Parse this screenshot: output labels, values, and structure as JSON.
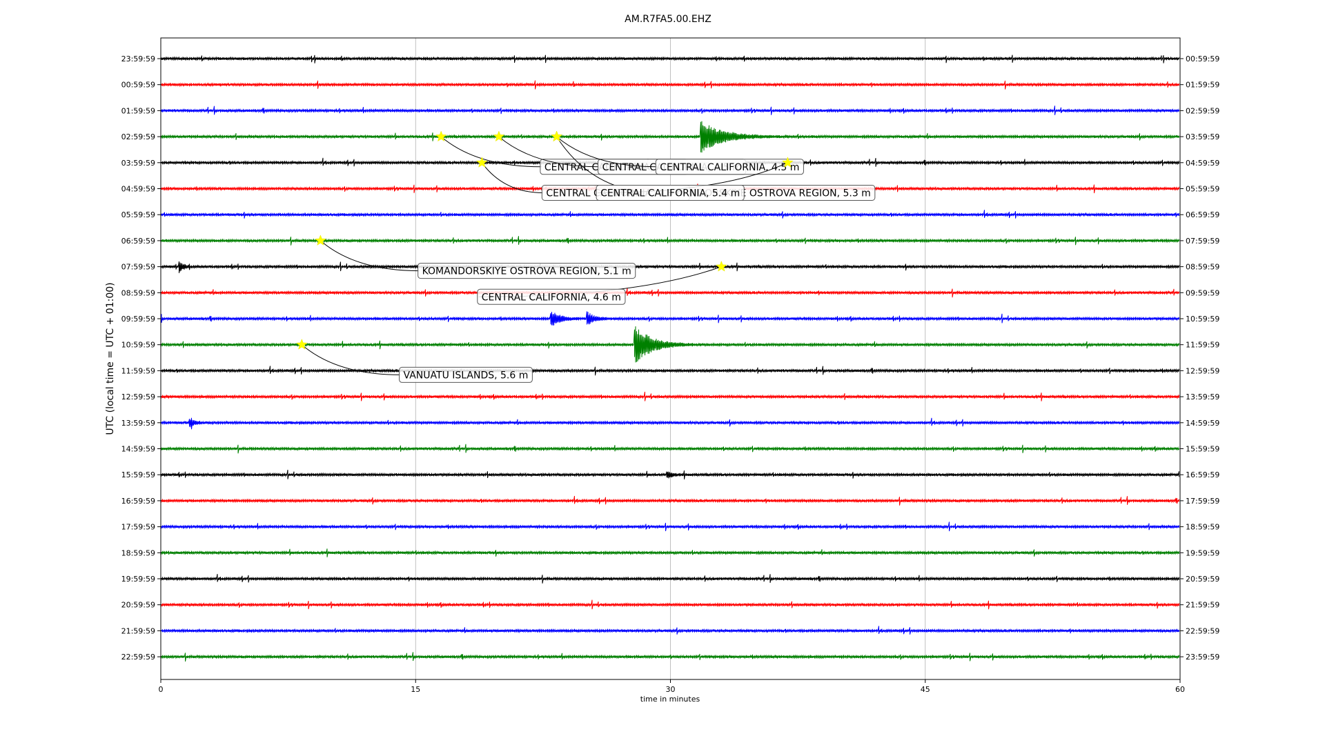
{
  "chart_data": {
    "type": "line",
    "title": "AM.R7FA5.00.EHZ",
    "xlabel": "time in minutes",
    "ylabel": "UTC (local time = UTC + 01:00)",
    "xlim": [
      0,
      60
    ],
    "x_ticks": [
      0,
      15,
      30,
      45,
      60
    ],
    "x_grid": true,
    "trace_colors": [
      "#000000",
      "#ff0000",
      "#0000ff",
      "#008000"
    ],
    "rows_left": [
      "23:59:59",
      "00:59:59",
      "01:59:59",
      "02:59:59",
      "03:59:59",
      "04:59:59",
      "05:59:59",
      "06:59:59",
      "07:59:59",
      "08:59:59",
      "09:59:59",
      "10:59:59",
      "11:59:59",
      "12:59:59",
      "13:59:59",
      "14:59:59",
      "15:59:59",
      "16:59:59",
      "17:59:59",
      "18:59:59",
      "19:59:59",
      "20:59:59",
      "21:59:59",
      "22:59:59"
    ],
    "rows_right": [
      "00:59:59",
      "01:59:59",
      "02:59:59",
      "03:59:59",
      "04:59:59",
      "05:59:59",
      "06:59:59",
      "07:59:59",
      "08:59:59",
      "09:59:59",
      "10:59:59",
      "11:59:59",
      "12:59:59",
      "13:59:59",
      "14:59:59",
      "15:59:59",
      "16:59:59",
      "17:59:59",
      "18:59:59",
      "19:59:59",
      "20:59:59",
      "21:59:59",
      "22:59:59",
      "23:59:59"
    ],
    "signals": [
      {
        "row": 3,
        "minute": 31.8,
        "amplitude": 22,
        "decay": 1.2
      },
      {
        "row": 11,
        "minute": 27.9,
        "amplitude": 28,
        "decay": 0.9
      },
      {
        "row": 10,
        "minute": 23.0,
        "amplitude": 11,
        "decay": 0.5
      },
      {
        "row": 10,
        "minute": 25.1,
        "amplitude": 9,
        "decay": 0.4
      },
      {
        "row": 8,
        "minute": 1.1,
        "amplitude": 9,
        "decay": 0.2
      },
      {
        "row": 14,
        "minute": 1.7,
        "amplitude": 6,
        "decay": 0.3
      },
      {
        "row": 16,
        "minute": 29.8,
        "amplitude": 5,
        "decay": 0.3
      }
    ],
    "events": [
      {
        "label": "CENTRAL CALIFORNIA, 4.5 m",
        "row": 3,
        "minute": 16.5,
        "label_row": 4,
        "label_minute": 22.5
      },
      {
        "label": "CENTRAL CALIFORNIA, 4.5 m",
        "row": 3,
        "minute": 19.9,
        "label_row": 4,
        "label_minute": 25.9
      },
      {
        "label": "CENTRAL CALIFORNIA, 4.5 m",
        "row": 3,
        "minute": 23.3,
        "label_row": 4,
        "label_minute": 29.3
      },
      {
        "label": "KOMANDORSKIYE OSTROVA REGION, 5.3 m",
        "row": 3,
        "minute": 23.3,
        "label_row": 5,
        "label_minute": 29.4
      },
      {
        "label": "CENTRAL CALIFORNIA, 4.8 m",
        "row": 4,
        "minute": 18.9,
        "label_row": 5,
        "label_minute": 22.6
      },
      {
        "label": "CENTRAL CALIFORNIA, 5.4 m",
        "row": 4,
        "minute": 36.9,
        "label_row": 5,
        "label_minute": 25.8
      },
      {
        "label": "KOMANDORSKIYE OSTROVA REGION, 5.1 m",
        "row": 7,
        "minute": 9.4,
        "label_row": 8,
        "label_minute": 15.3
      },
      {
        "label": "CENTRAL CALIFORNIA, 4.6 m",
        "row": 8,
        "minute": 33.0,
        "label_row": 9,
        "label_minute": 18.8
      },
      {
        "label": "VANUATU ISLANDS, 5.6 m",
        "row": 11,
        "minute": 8.3,
        "label_row": 12,
        "label_minute": 14.2
      }
    ]
  }
}
